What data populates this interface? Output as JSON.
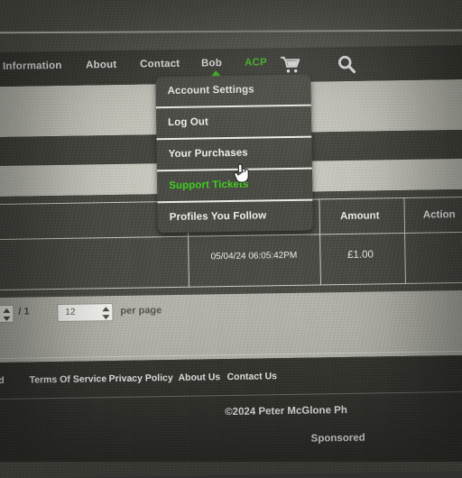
{
  "navbar": {
    "items": [
      {
        "label": "Information",
        "id": "information"
      },
      {
        "label": "About",
        "id": "about"
      },
      {
        "label": "Contact",
        "id": "contact"
      },
      {
        "label": "Bob",
        "id": "user"
      },
      {
        "label": "ACP",
        "id": "acp"
      }
    ],
    "icons": [
      "cart-icon",
      "search-icon"
    ],
    "accent_green": "#3fbf1f",
    "bar_color": "#3c3d36",
    "text_color": "#ececed"
  },
  "dropdown": {
    "owner": "Bob",
    "open": true,
    "items": [
      {
        "label": "Account Settings",
        "active": false
      },
      {
        "label": "Log Out",
        "active": false
      },
      {
        "label": "Your Purchases",
        "active": false
      },
      {
        "label": "Support Tickets",
        "active": true
      },
      {
        "label": "Profiles You Follow",
        "active": false
      }
    ],
    "active_color": "#3ed11c",
    "background": "#4a4b44"
  },
  "cursor": {
    "type": "pointing-hand-cursor",
    "over": "Support Tickets"
  },
  "table": {
    "headers": [
      "Amount",
      "Action"
    ],
    "rows": [
      {
        "date": "05/04/24 06:05:42PM",
        "amount": "£1.00",
        "action": ""
      }
    ],
    "border_color": "#cfcfc7"
  },
  "pager": {
    "page_value": "",
    "page_of": "/ 1",
    "per_page_value": "12",
    "per_page_label": "per page"
  },
  "footer": {
    "links": [
      {
        "label": "loud"
      },
      {
        "label": "Terms Of Service"
      },
      {
        "label": "Privacy Policy"
      },
      {
        "label": "About Us"
      },
      {
        "label": "Contact Us"
      }
    ],
    "copyright": "©2024 Peter McGlone Ph",
    "sponsored": "Sponsored"
  }
}
